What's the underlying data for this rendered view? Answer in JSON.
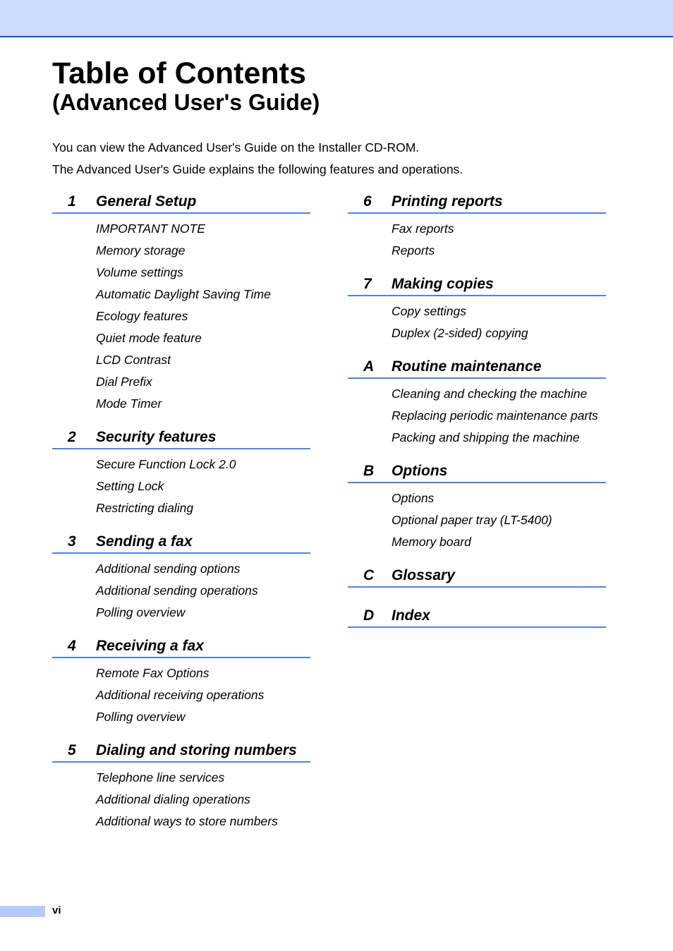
{
  "header": {
    "title": "Table of Contents",
    "subtitle": "(Advanced User's Guide)"
  },
  "intro": [
    "You can view the Advanced User's Guide on the Installer CD-ROM.",
    "The Advanced User's Guide explains the following features and operations."
  ],
  "colors": {
    "header_band": "#ccdcfd",
    "header_rule": "#0050f2",
    "chapter_rule": "#4a84e8",
    "footer_tab": "#b3cbfd"
  },
  "left_column": [
    {
      "num": "1",
      "title": "General Setup",
      "topics": [
        "IMPORTANT NOTE",
        "Memory storage",
        "Volume settings",
        "Automatic Daylight Saving Time",
        "Ecology features",
        "Quiet mode feature",
        "LCD Contrast",
        "Dial Prefix",
        "Mode Timer"
      ]
    },
    {
      "num": "2",
      "title": "Security features",
      "topics": [
        "Secure Function Lock 2.0",
        "Setting Lock",
        "Restricting dialing"
      ]
    },
    {
      "num": "3",
      "title": "Sending a fax",
      "topics": [
        "Additional sending options",
        "Additional sending operations",
        "Polling overview"
      ]
    },
    {
      "num": "4",
      "title": "Receiving a fax",
      "topics": [
        "Remote Fax Options",
        "Additional receiving operations",
        "Polling overview"
      ]
    },
    {
      "num": "5",
      "title": "Dialing and storing numbers",
      "topics": [
        "Telephone line services",
        "Additional dialing operations",
        "Additional ways to store numbers"
      ]
    }
  ],
  "right_column": [
    {
      "num": "6",
      "title": "Printing reports",
      "topics": [
        "Fax reports",
        "Reports"
      ]
    },
    {
      "num": "7",
      "title": "Making copies",
      "topics": [
        "Copy settings",
        "Duplex (2-sided) copying"
      ]
    },
    {
      "num": "A",
      "title": "Routine maintenance",
      "topics": [
        "Cleaning and checking the machine",
        "Replacing periodic maintenance parts",
        "Packing and shipping the machine"
      ]
    },
    {
      "num": "B",
      "title": "Options",
      "topics": [
        "Options",
        "Optional paper tray (LT-5400)",
        "Memory board"
      ]
    },
    {
      "num": "C",
      "title": "Glossary",
      "topics": []
    },
    {
      "num": "D",
      "title": "Index",
      "topics": []
    }
  ],
  "footer": {
    "page_number": "vi"
  }
}
